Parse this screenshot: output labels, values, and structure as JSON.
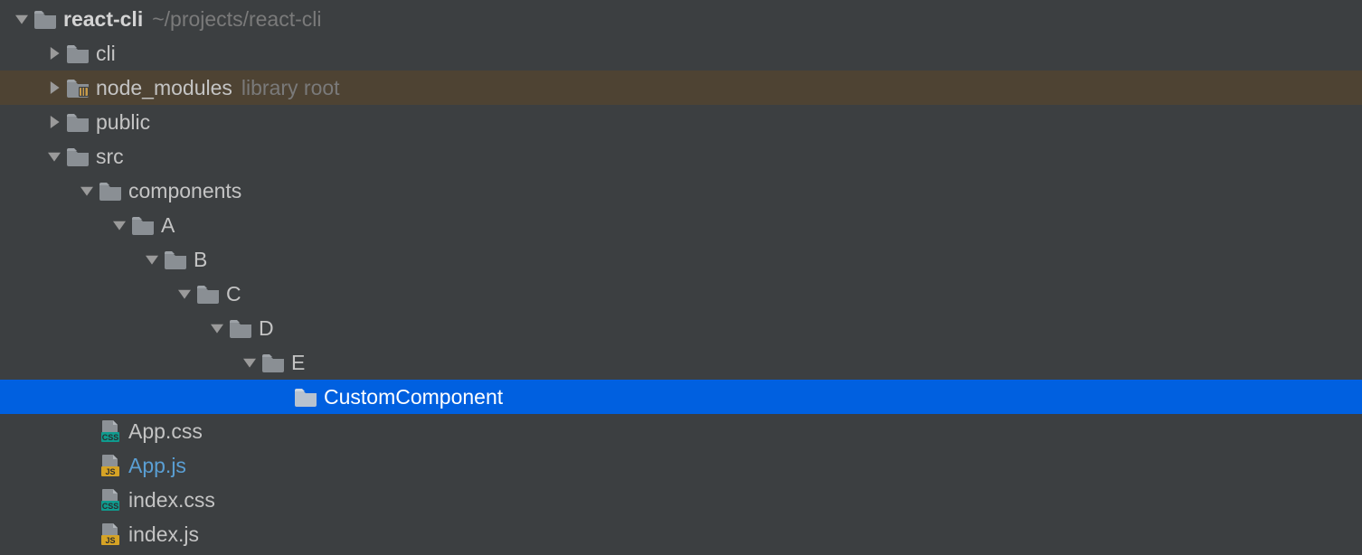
{
  "root": {
    "name": "react-cli",
    "path": "~/projects/react-cli"
  },
  "items": {
    "cli": "cli",
    "node_modules": "node_modules",
    "library_root": "library root",
    "public": "public",
    "src": "src",
    "components": "components",
    "A": "A",
    "B": "B",
    "C": "C",
    "D": "D",
    "E": "E",
    "CustomComponent": "CustomComponent",
    "app_css": "App.css",
    "app_js": "App.js",
    "index_css": "index.css",
    "index_js": "index.js"
  }
}
